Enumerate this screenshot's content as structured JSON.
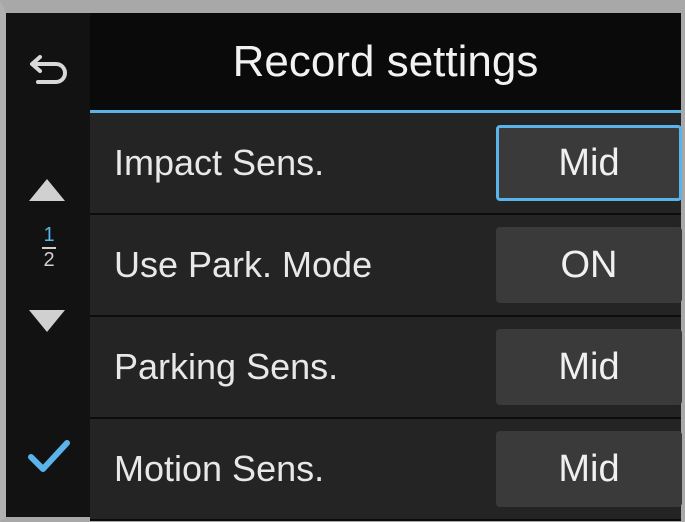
{
  "header": {
    "title": "Record settings"
  },
  "sidebar": {
    "page_current": "1",
    "page_total": "2",
    "icons": [
      "back-icon",
      "up-arrow-icon",
      "down-arrow-icon",
      "check-icon"
    ]
  },
  "settings": [
    {
      "label": "Impact Sens.",
      "value": "Mid",
      "selected": true
    },
    {
      "label": "Use Park. Mode",
      "value": "ON",
      "selected": false
    },
    {
      "label": "Parking Sens.",
      "value": "Mid",
      "selected": false
    },
    {
      "label": "Motion Sens.",
      "value": "Mid",
      "selected": false
    }
  ],
  "colors": {
    "accent": "#5ab4ea",
    "background": "#1e1e1e",
    "button": "#3a3a3a"
  }
}
